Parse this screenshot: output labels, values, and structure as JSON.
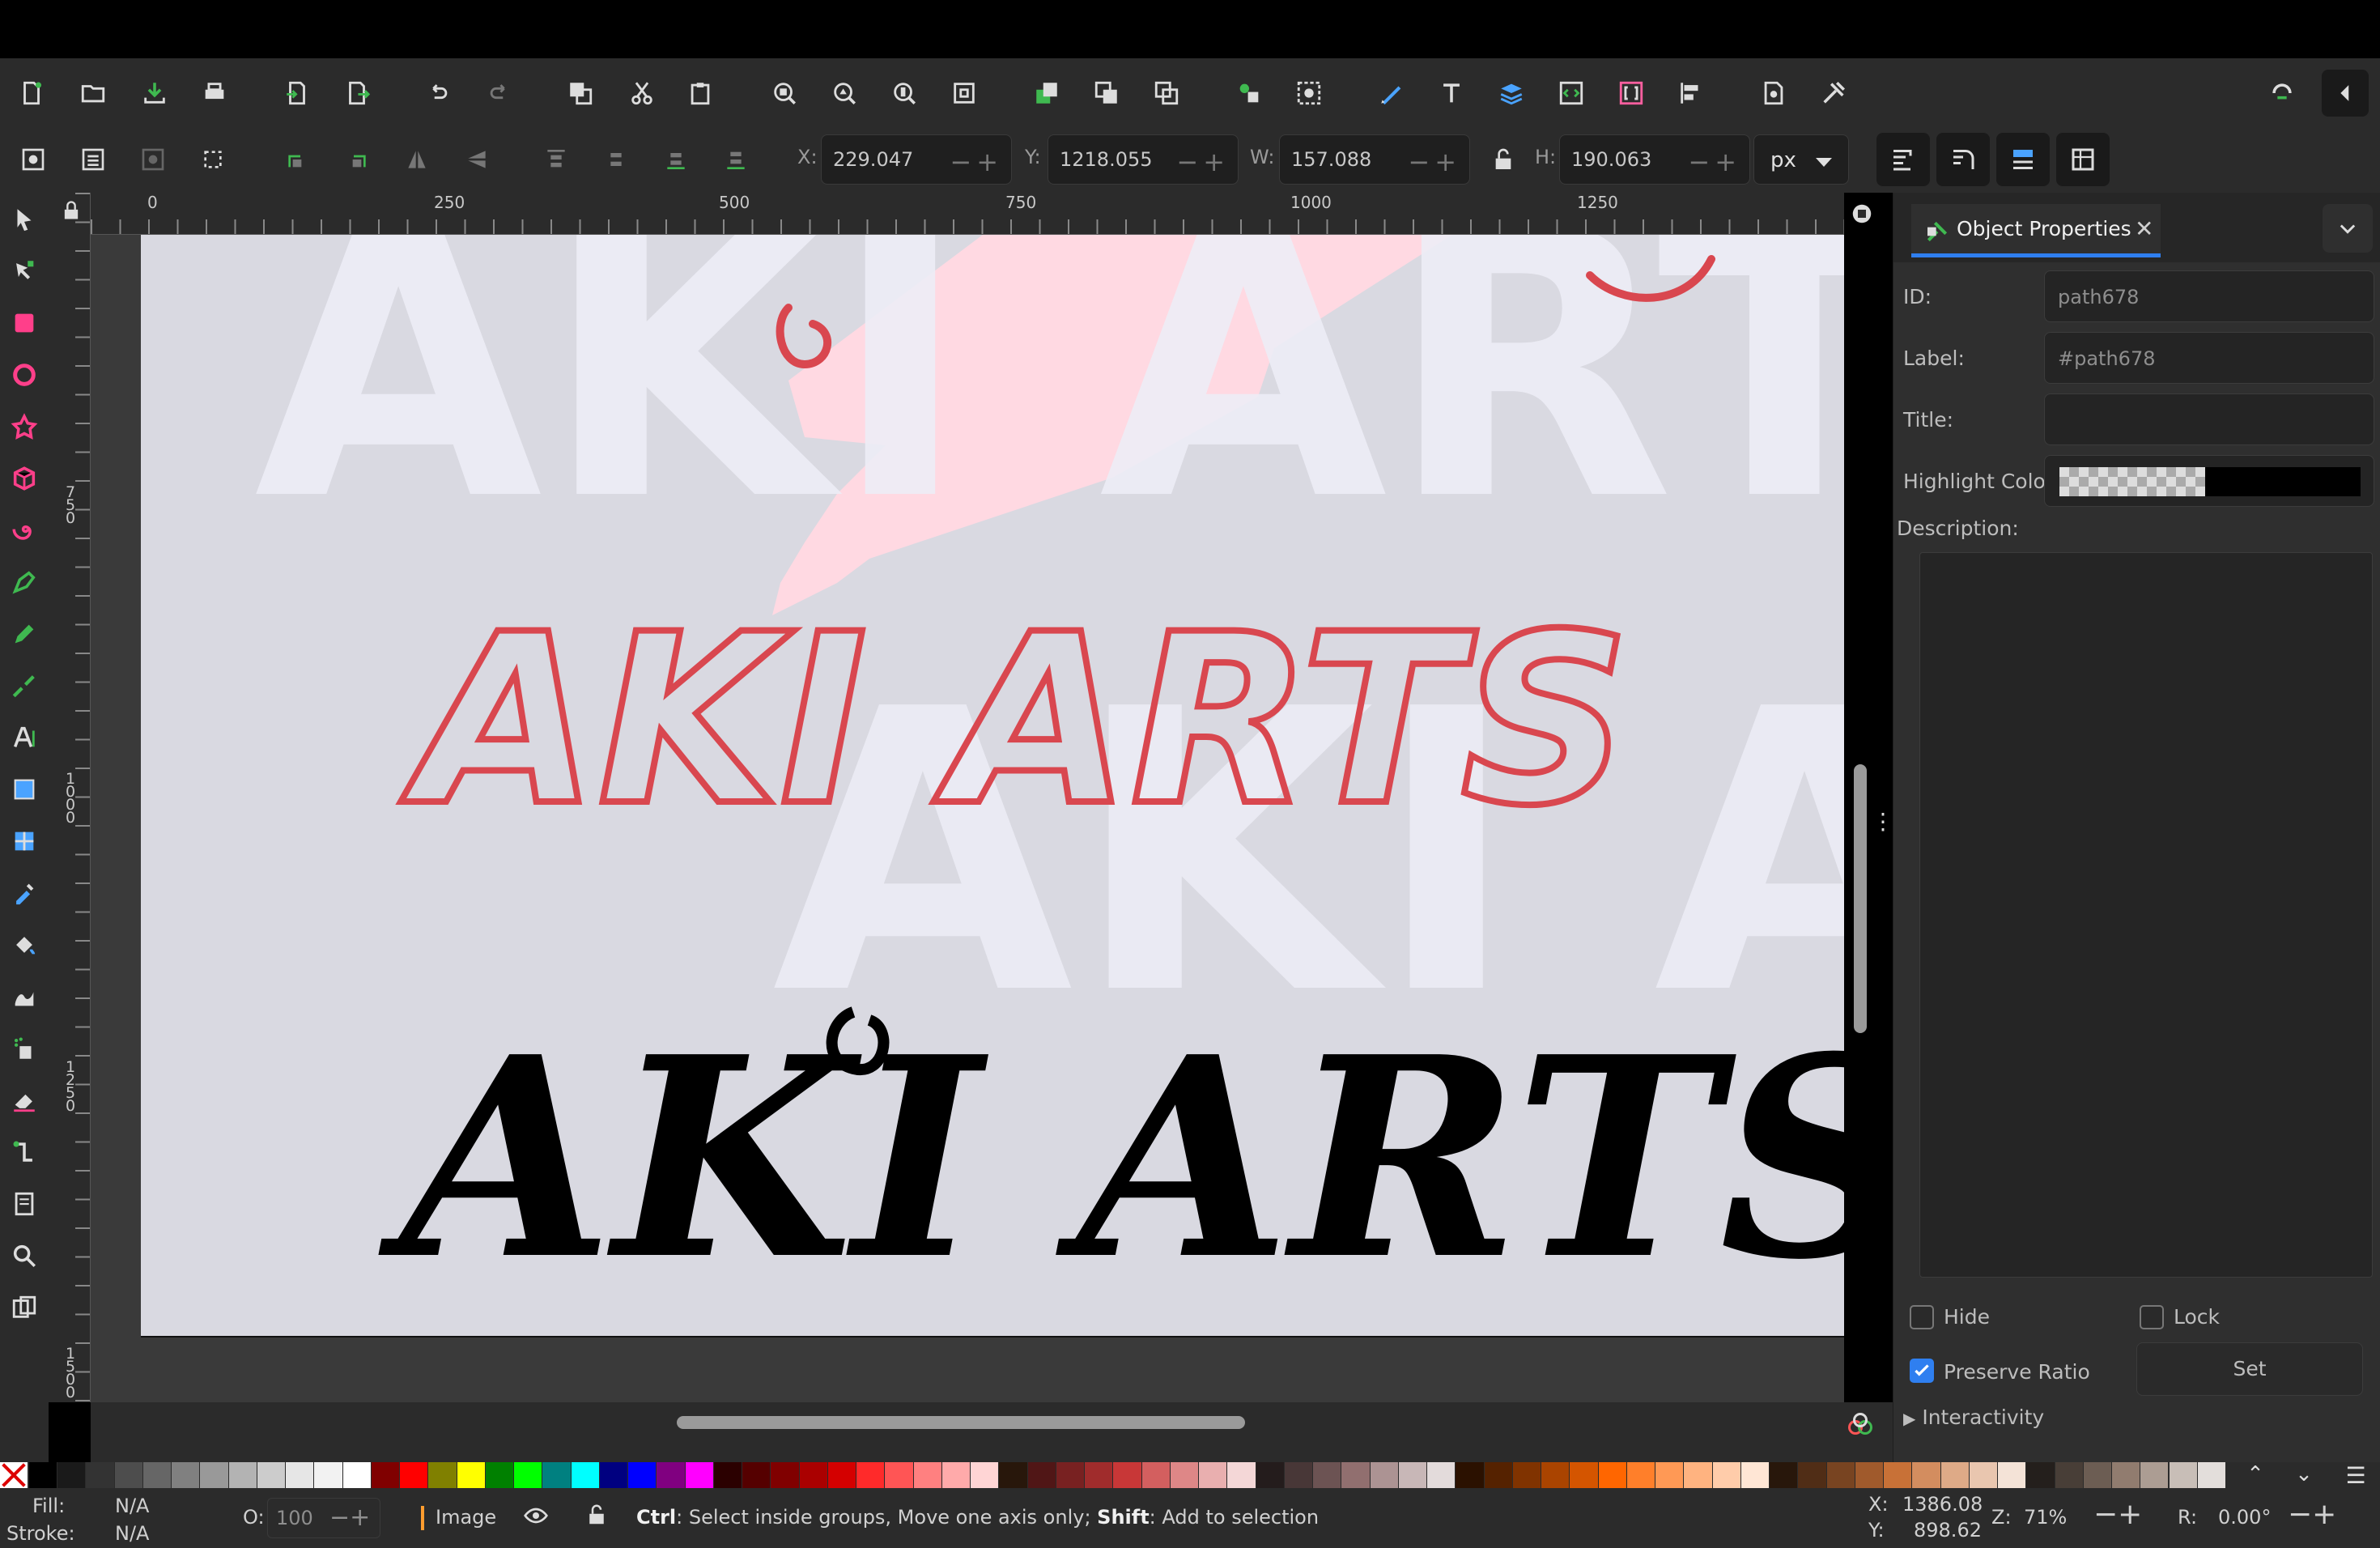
{
  "toolbar": {
    "commands": [
      "new-document-icon",
      "open-icon",
      "save-icon",
      "print-icon",
      "import-icon",
      "export-icon",
      "undo-icon",
      "redo-icon",
      "duplicate-icon",
      "cut-icon",
      "paste-icon",
      "zoom-selection-icon",
      "zoom-drawing-icon",
      "zoom-page-icon",
      "zoom-fit-icon",
      "raise-icon",
      "clone-icon",
      "unlink-clone-icon",
      "group-icon",
      "ungroup-icon",
      "fill-stroke-icon",
      "text-font-icon",
      "layers-icon",
      "xml-editor-icon",
      "object-props-icon",
      "align-icon",
      "document-props-icon",
      "preferences-icon",
      "snap-icon",
      "collapse-icon"
    ]
  },
  "controls": {
    "x": {
      "label": "X:",
      "value": "229.047"
    },
    "y": {
      "label": "Y:",
      "value": "1218.055"
    },
    "w": {
      "label": "W:",
      "value": "157.088"
    },
    "h": {
      "label": "H:",
      "value": "190.063"
    },
    "unit": "px"
  },
  "ruler": {
    "h_labels": [
      "0",
      "250",
      "500",
      "750",
      "1000",
      "1250"
    ],
    "v_labels": [
      "750",
      "1000",
      "1250",
      "1500"
    ]
  },
  "canvas": {
    "sketch_text": "AKI ARTS",
    "ghost_text": "AKI ARTS",
    "final_text": "AKI ARTS",
    "sketch_color": "#d9474f",
    "final_color": "#000000",
    "ghost_color": "#eeeef7",
    "pink_color": "#ffd9e2"
  },
  "panel": {
    "tab_label": "Object Properties",
    "id_label": "ID:",
    "id_value": "path678",
    "label_label": "Label:",
    "label_value": "#path678",
    "title_label": "Title:",
    "title_value": "",
    "highlight_label": "Highlight Color:",
    "description_label": "Description:",
    "hide_label": "Hide",
    "lock_label": "Lock",
    "preserve_label": "Preserve Ratio",
    "preserve_checked": true,
    "set_label": "Set",
    "interactivity_label": "Interactivity"
  },
  "palette": [
    "#000000",
    "#1a1a1a",
    "#333333",
    "#4d4d4d",
    "#666666",
    "#808080",
    "#999999",
    "#b3b3b3",
    "#cccccc",
    "#e6e6e6",
    "#f2f2f2",
    "#ffffff",
    "#800000",
    "#ff0000",
    "#808000",
    "#ffff00",
    "#008000",
    "#00ff00",
    "#008080",
    "#00ffff",
    "#000080",
    "#0000ff",
    "#800080",
    "#ff00ff",
    "#2b0000",
    "#550000",
    "#800000",
    "#aa0000",
    "#d40000",
    "#ff2a2a",
    "#ff5555",
    "#ff8080",
    "#ffaaaa",
    "#ffd5d5",
    "#28170b",
    "#501616",
    "#782121",
    "#a02c2c",
    "#c83737",
    "#d35f5f",
    "#de8787",
    "#e9afaf",
    "#f4d7d7",
    "#241c1c",
    "#483737",
    "#6c5353",
    "#916f6f",
    "#ac9393",
    "#c8b7b7",
    "#e3dbdb",
    "#2b1100",
    "#552200",
    "#803300",
    "#aa4400",
    "#d45500",
    "#ff6600",
    "#ff7f2a",
    "#ff9955",
    "#ffb380",
    "#ffccaa",
    "#ffe6d5",
    "#28170b",
    "#502d16",
    "#784421",
    "#a05a2c",
    "#c87137",
    "#d38d5f",
    "#deaa87",
    "#e9c6af",
    "#f4e3d7",
    "#241f1c",
    "#483e37",
    "#6c5d53",
    "#917c6f",
    "#ac9d93",
    "#c8beb7",
    "#e3dedb"
  ],
  "status": {
    "fill_label": "Fill:",
    "fill_value": "N/A",
    "stroke_label": "Stroke:",
    "stroke_value": "N/A",
    "opacity_label": "O:",
    "opacity_value": "100",
    "layer_label": "Image",
    "hint_bold1": "Ctrl",
    "hint_text1": ": Select inside groups, Move one axis only; ",
    "hint_bold2": "Shift",
    "hint_text2": ": Add to selection",
    "cursor_x_label": "X:",
    "cursor_x": "1386.08",
    "cursor_y_label": "Y:",
    "cursor_y": "898.62",
    "zoom_label": "Z:",
    "zoom": "71%",
    "rotate_label": "R:",
    "rotate": "0.00°"
  }
}
